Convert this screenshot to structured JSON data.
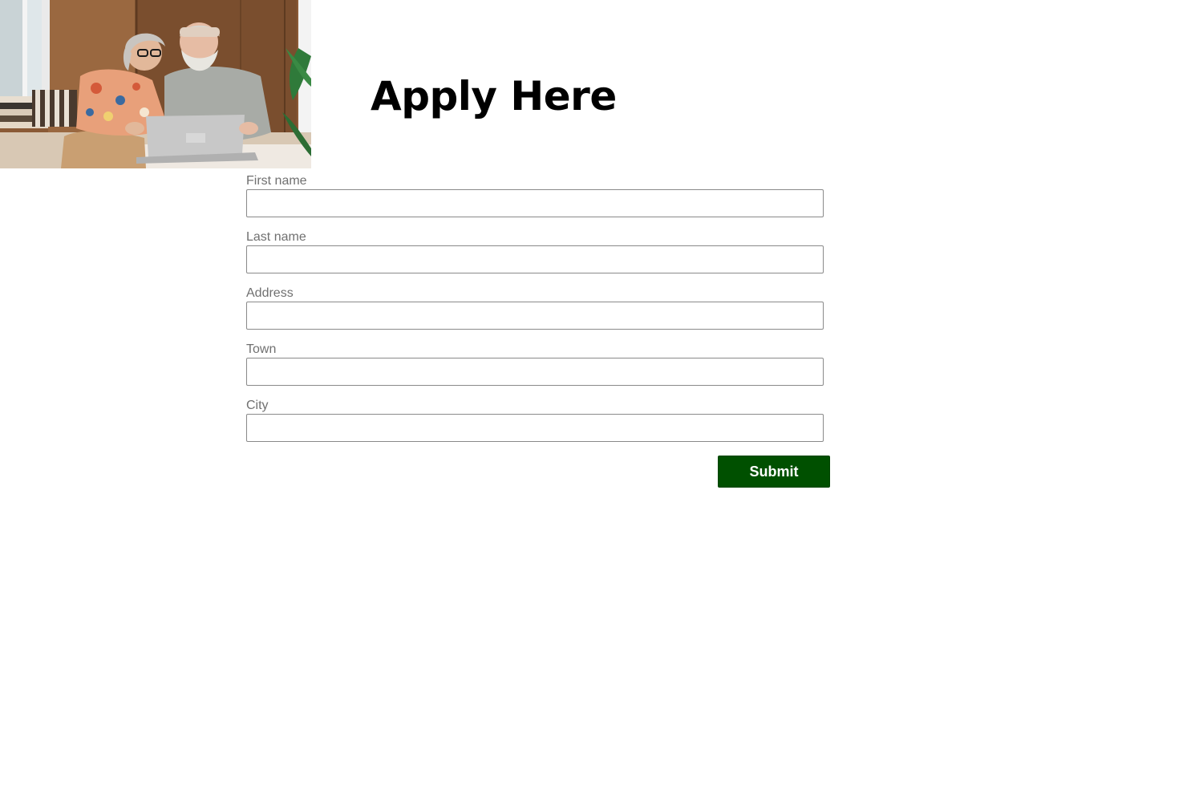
{
  "header": {
    "title": "Apply Here"
  },
  "hero_image": {
    "description": "Couple sitting together looking at a laptop"
  },
  "form": {
    "fields": [
      {
        "id": "first-name",
        "label": "First name",
        "value": "",
        "placeholder": ""
      },
      {
        "id": "last-name",
        "label": "Last name",
        "value": "",
        "placeholder": ""
      },
      {
        "id": "address",
        "label": "Address",
        "value": "",
        "placeholder": ""
      },
      {
        "id": "town",
        "label": "Town",
        "value": "",
        "placeholder": ""
      },
      {
        "id": "city",
        "label": "City",
        "value": "",
        "placeholder": ""
      }
    ],
    "submit_label": "Submit"
  },
  "colors": {
    "submit_background": "#005000",
    "submit_text": "#ffffff",
    "label_text": "#707070",
    "input_border": "#8a8a8a",
    "title_text": "#000000"
  }
}
